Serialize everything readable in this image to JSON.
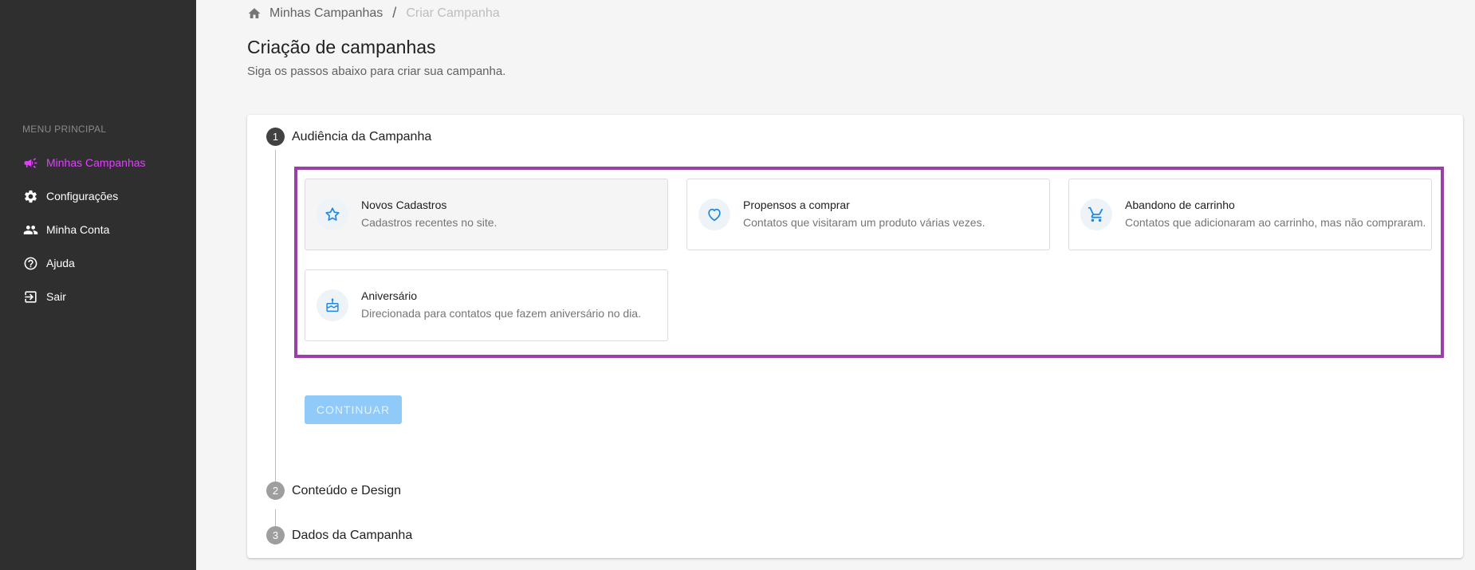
{
  "sidebar": {
    "menu_heading": "MENU PRINCIPAL",
    "items": [
      {
        "label": "Minhas Campanhas",
        "icon": "megaphone-icon",
        "active": true
      },
      {
        "label": "Configurações",
        "icon": "gear-icon"
      },
      {
        "label": "Minha Conta",
        "icon": "people-icon"
      },
      {
        "label": "Ajuda",
        "icon": "help-circle-icon"
      },
      {
        "label": "Sair",
        "icon": "logout-icon"
      }
    ],
    "active_color": "#e040fb"
  },
  "breadcrumb": {
    "home_icon": "home-icon",
    "link": "Minhas Campanhas",
    "separator": "/",
    "current": "Criar Campanha"
  },
  "header": {
    "title": "Criação de campanhas",
    "subtitle": "Siga os passos abaixo para criar sua campanha."
  },
  "stepper": {
    "steps": [
      {
        "number": "1",
        "label": "Audiência da Campanha",
        "active": true
      },
      {
        "number": "2",
        "label": "Conteúdo e Design"
      },
      {
        "number": "3",
        "label": "Dados da Campanha"
      }
    ],
    "options": [
      {
        "title": "Novos Cadastros",
        "description": "Cadastros recentes no site.",
        "icon": "star-icon",
        "selected": true
      },
      {
        "title": "Propensos a comprar",
        "description": "Contatos que visitaram um produto várias vezes.",
        "icon": "heart-icon"
      },
      {
        "title": "Abandono de carrinho",
        "description": "Contatos que adicionaram ao carrinho, mas não compraram.",
        "icon": "cart-icon"
      },
      {
        "title": "Aniversário",
        "description": "Direcionada para contatos que fazem aniversário no dia.",
        "icon": "cake-icon"
      }
    ],
    "continue_label": "Continuar",
    "highlight_color": "#9b3fa8",
    "icon_color": "#1e88e5"
  }
}
